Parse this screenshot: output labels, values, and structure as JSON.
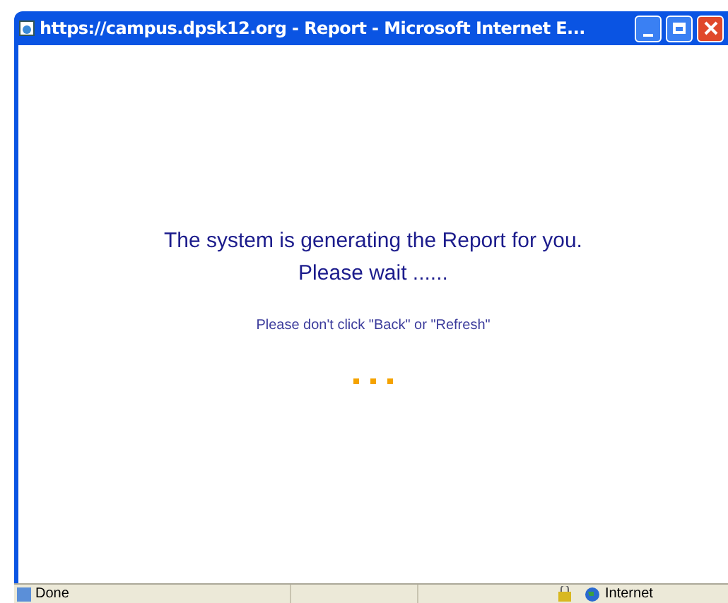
{
  "window": {
    "title": "https://campus.dpsk12.org - Report - Microsoft Internet E..."
  },
  "message": {
    "heading": "The system is generating the Report for you.",
    "subheading": "Please wait ......",
    "note": "Please don't click \"Back\" or \"Refresh\""
  },
  "status_bar": {
    "status": "Done",
    "zone": "Internet"
  }
}
